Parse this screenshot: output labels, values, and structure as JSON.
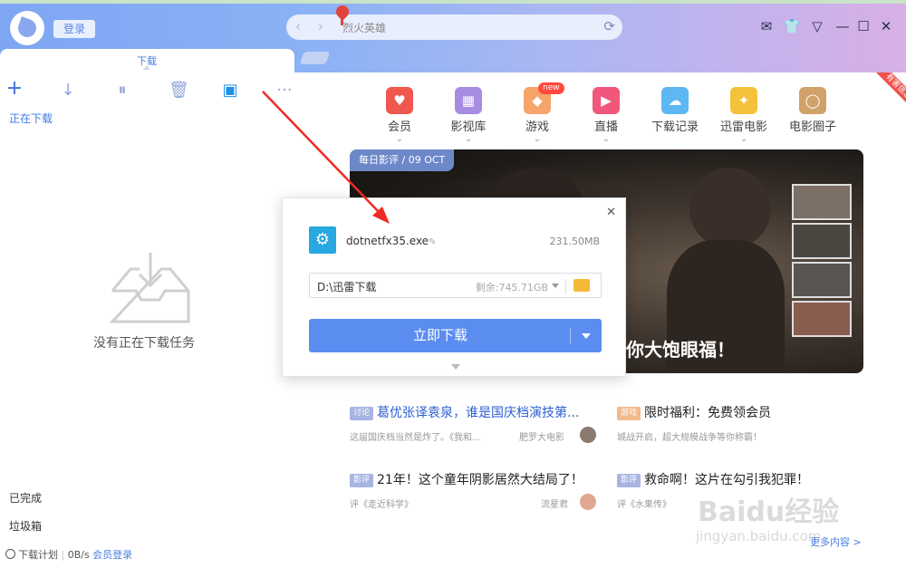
{
  "header": {
    "login_label": "登录",
    "search_value": "烈火英雄"
  },
  "window_controls": [
    "mail-icon",
    "skin-icon",
    "menu-icon",
    "minimize-icon",
    "maximize-icon",
    "close-icon"
  ],
  "tabs": {
    "active_label": "下载"
  },
  "sidebar": {
    "status_label": "正在下载",
    "empty_text": "没有正在下载任务",
    "completed_label": "已完成",
    "trash_label": "垃圾箱",
    "plan_label": "下载计划",
    "speed": "0B/s",
    "member_login": "会员登录"
  },
  "nav": [
    {
      "label": "会员",
      "icon": "vip-icon",
      "color": "#f0574f",
      "chevron": true
    },
    {
      "label": "影视库",
      "icon": "film-icon",
      "color": "#a88be2",
      "chevron": true
    },
    {
      "label": "游戏",
      "icon": "game-icon",
      "color": "#f5a46a",
      "chevron": true
    },
    {
      "label": "直播",
      "icon": "live-icon",
      "color": "#f0577a",
      "chevron": true
    },
    {
      "label": "下载记录",
      "icon": "cloud-icon",
      "color": "#5cb7f2",
      "chevron": false
    },
    {
      "label": "迅雷电影",
      "icon": "thunder-icon",
      "color": "#f4c13a",
      "chevron": true
    },
    {
      "label": "电影圈子",
      "icon": "circle-icon",
      "color": "#d1a16a",
      "chevron": false
    }
  ],
  "new_badge": "new",
  "corner_ribbon": "有害信息",
  "banner": {
    "tag": "每日影评 / 09 OCT",
    "caption": "你大饱眼福！"
  },
  "articles": [
    {
      "tag": "讨论",
      "title": "葛优张译袁泉，谁是国庆档演技第...",
      "sub": "这届国庆档当然是炸了。《我和...",
      "author": "肥罗大电影"
    },
    {
      "tag": "游戏",
      "title": "限时福利：免费领会员",
      "sub": "城战开启，超大规模战争等你称霸！"
    },
    {
      "tag": "影评",
      "title": "21年！这个童年阴影居然大结局了！",
      "sub": "评《走近科学》",
      "author": "流星君"
    },
    {
      "tag": "影评",
      "title": "救命啊！这片在勾引我犯罪！",
      "sub": "评《水果传》"
    }
  ],
  "more_link": "更多内容 >",
  "watermark": {
    "main": "Baidu经验",
    "sub": "jingyan.baidu.com"
  },
  "dialog": {
    "file_name": "dotnetfx35.exe",
    "file_size": "231.50MB",
    "save_path": "D:\\迅雷下载",
    "free_space": "剩余:745.71GB",
    "download_label": "立即下载"
  }
}
